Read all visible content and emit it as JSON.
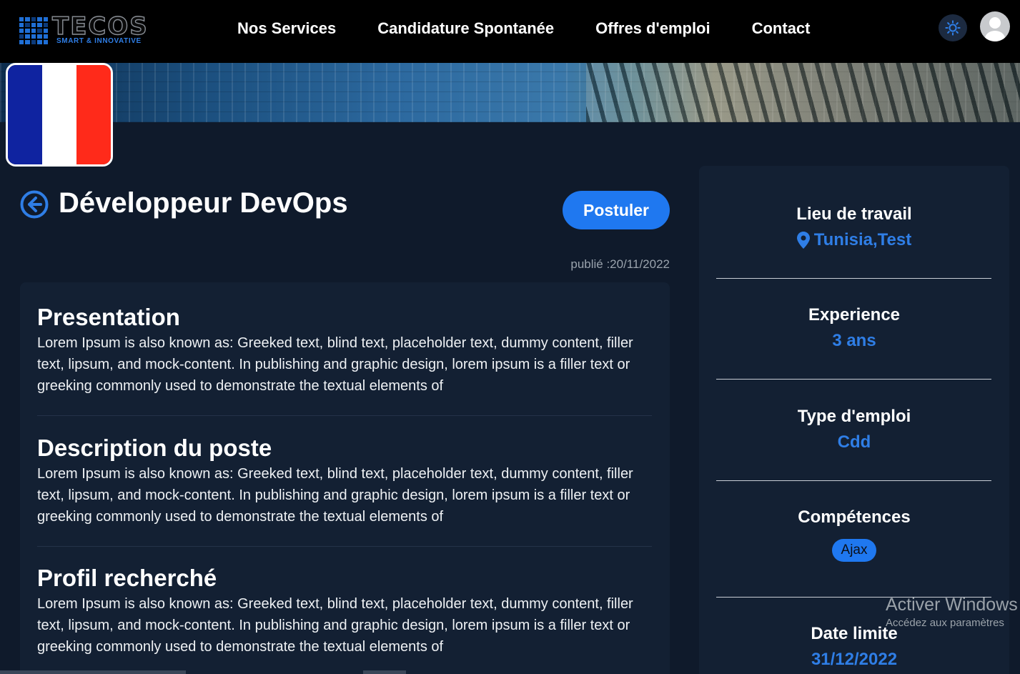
{
  "header": {
    "logo_main": "TECOS",
    "logo_sub": "SMART & INNOVATIVE",
    "nav": [
      {
        "label": "Nos Services"
      },
      {
        "label": "Candidature Spontanée"
      },
      {
        "label": "Offres d'emploi"
      },
      {
        "label": "Contact"
      }
    ],
    "theme_icon": "sun-icon",
    "avatar_icon": "user-avatar-icon"
  },
  "job": {
    "title": "Développeur DevOps",
    "apply_label": "Postuler",
    "published": "publié :20/11/2022",
    "flag_colors": [
      "#0f23a0",
      "#ffffff",
      "#ff2a1a"
    ]
  },
  "sections": [
    {
      "heading": "Presentation",
      "body": "Lorem Ipsum is also known as: Greeked text, blind text, placeholder text, dummy content, filler text, lipsum, and mock-content. In publishing and graphic design, lorem ipsum is a filler text or greeking commonly used to demonstrate the textual elements of"
    },
    {
      "heading": "Description du poste",
      "body": "Lorem Ipsum is also known as: Greeked text, blind text, placeholder text, dummy content, filler text, lipsum, and mock-content. In publishing and graphic design, lorem ipsum is a filler text or greeking commonly used to demonstrate the textual elements of"
    },
    {
      "heading": "Profil recherché",
      "body": "Lorem Ipsum is also known as: Greeked text, blind text, placeholder text, dummy content, filler text, lipsum, and mock-content. In publishing and graphic design, lorem ipsum is a filler text or greeking commonly used to demonstrate the textual elements of"
    }
  ],
  "sidebar": {
    "location_label": "Lieu de travail",
    "location_value": "Tunisia,Test",
    "experience_label": "Experience",
    "experience_value": "3 ans",
    "type_label": "Type d'emploi",
    "type_value": "Cdd",
    "skills_label": "Compétences",
    "skills": [
      "Ajax"
    ],
    "deadline_label": "Date limite",
    "deadline_value": "31/12/2022"
  },
  "watermark": {
    "line1": "Activer Windows",
    "line2": "Accédez aux paramètres"
  },
  "colors": {
    "accent": "#1f78f0",
    "link": "#2f7ee6",
    "background": "#0f1a2b",
    "card": "#132033"
  }
}
